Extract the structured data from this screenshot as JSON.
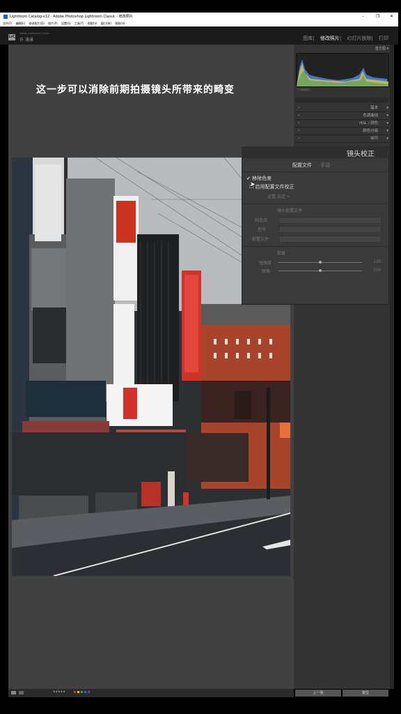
{
  "window": {
    "title": "Lightroom Catalog-v12 - Adobe Photoshop Lightroom Classic - 修改照片",
    "controls": [
      "–",
      "❐",
      "✕"
    ],
    "menus": [
      "文件(F)",
      "编辑(E)",
      "修改照片(D)",
      "照片(P)",
      "设置(S)",
      "工具(T)",
      "视图(V)",
      "窗口(W)",
      "帮助(H)"
    ]
  },
  "app": {
    "logo": "LrC",
    "product_small": "Adobe Lightroom Classic",
    "user": "许 涌涌",
    "modules": [
      "图库",
      "修改照片",
      "幻灯片放映",
      "打印"
    ],
    "active_module": "修改照片"
  },
  "overlay_caption": "这一步可以消除前期拍摄镜头所带来的畸变",
  "histogram": {
    "label": "直方图",
    "info": [
      "ISO 100",
      "35 mm",
      "f / 5.6",
      "1/400 秒"
    ],
    "original_photo": "原始照片"
  },
  "panels": [
    {
      "label": "基本"
    },
    {
      "label": "色调曲线"
    },
    {
      "label": "HSL / 颜色"
    },
    {
      "label": "颜色分级"
    },
    {
      "label": "细节"
    }
  ],
  "lens": {
    "title": "镜头校正",
    "tabs": [
      "配置文件",
      "手动"
    ],
    "remove_ca": "移除色差",
    "enable_profile": "启用配置文件校正",
    "setup_label": "设置",
    "setup_value": "自定",
    "profile_header": "镜头配置文件",
    "fields": [
      {
        "label": "制造商",
        "value": ""
      },
      {
        "label": "型号",
        "value": ""
      },
      {
        "label": "配置文件",
        "value": ""
      }
    ],
    "amount_header": "数量",
    "sliders": [
      {
        "label": "扭曲度",
        "value": "100",
        "level": 0.5
      },
      {
        "label": "暗角",
        "value": "100",
        "level": 0.5
      }
    ]
  },
  "buttons": {
    "previous": "上一张",
    "reset": "复位"
  },
  "colors": {
    "panel": "#333333",
    "canvas": "#414141",
    "accent_red": "#d0322a"
  }
}
